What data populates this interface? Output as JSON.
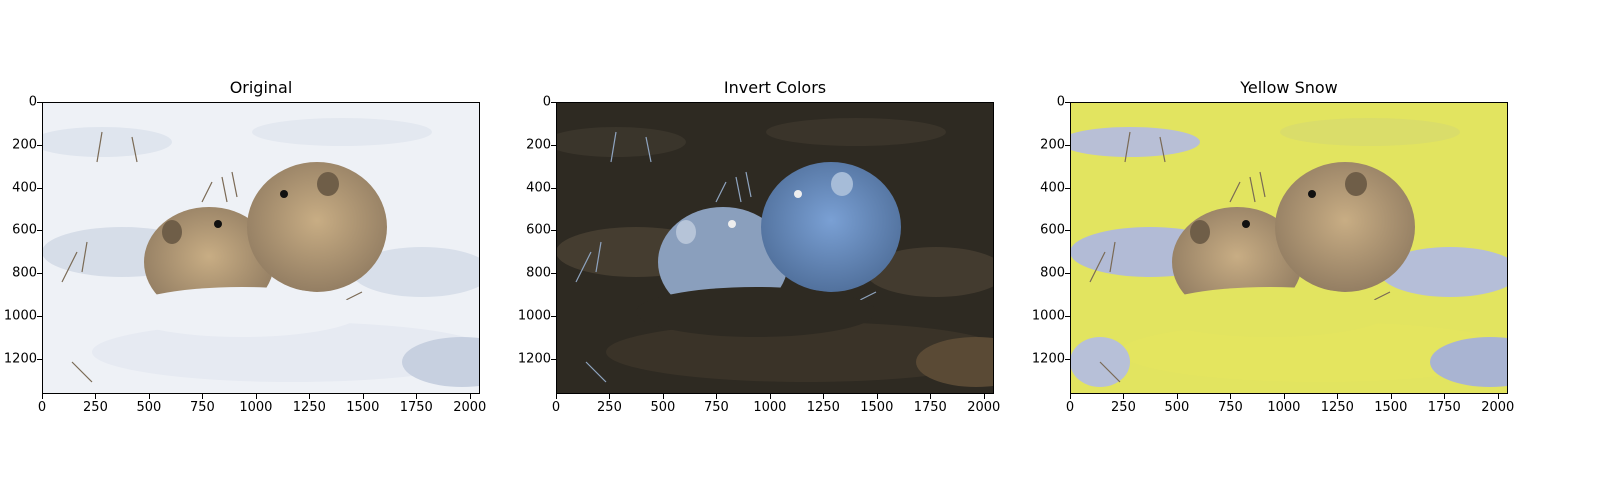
{
  "panels": [
    {
      "title": "Original",
      "variant": "original"
    },
    {
      "title": "Invert Colors",
      "variant": "inverted"
    },
    {
      "title": "Yellow Snow",
      "variant": "yellow"
    }
  ],
  "axes": {
    "y_ticks": [
      "0",
      "200",
      "400",
      "600",
      "800",
      "1000",
      "1200"
    ],
    "x_ticks": [
      "0",
      "250",
      "500",
      "750",
      "1000",
      "1250",
      "1500",
      "1750",
      "2000"
    ]
  },
  "palette": {
    "snow": "#eef1f6",
    "snow_shadow": "#c7d0e0",
    "fur": "#b59a72",
    "fur_dark": "#8f7a60",
    "inverted_bg": "#2e2a22",
    "inverted_fur": "#5f7fb0",
    "yellow_snow": "#e2e460"
  }
}
